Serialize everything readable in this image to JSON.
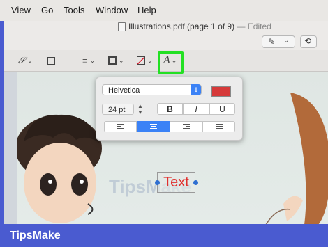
{
  "menubar": {
    "items": [
      "View",
      "Go",
      "Tools",
      "Window",
      "Help"
    ]
  },
  "document": {
    "title": "Illustrations.pdf (page 1 of 9)",
    "status": "— Edited"
  },
  "toolbar": {
    "icons": [
      "pen-markup-icon",
      "share-icon",
      "signature-icon",
      "note-icon",
      "line-style-icon",
      "border-color-icon",
      "fill-color-icon",
      "text-style-icon"
    ]
  },
  "text_style_popover": {
    "font_family": "Helvetica",
    "font_size": "24 pt",
    "bold_label": "B",
    "italic_label": "I",
    "underline_label": "U",
    "color": "#d63a3a",
    "alignment_options": [
      "left",
      "center",
      "right",
      "justify"
    ],
    "selected_alignment": "center"
  },
  "canvas": {
    "text_annotation": "Text"
  },
  "watermark": "TipsMake",
  "footer": {
    "brand": "TipsMake"
  },
  "colors": {
    "accent": "#3b82f6",
    "highlight": "#23e023",
    "text_red": "#e0302e",
    "brand_bg": "#4a5bd0"
  }
}
